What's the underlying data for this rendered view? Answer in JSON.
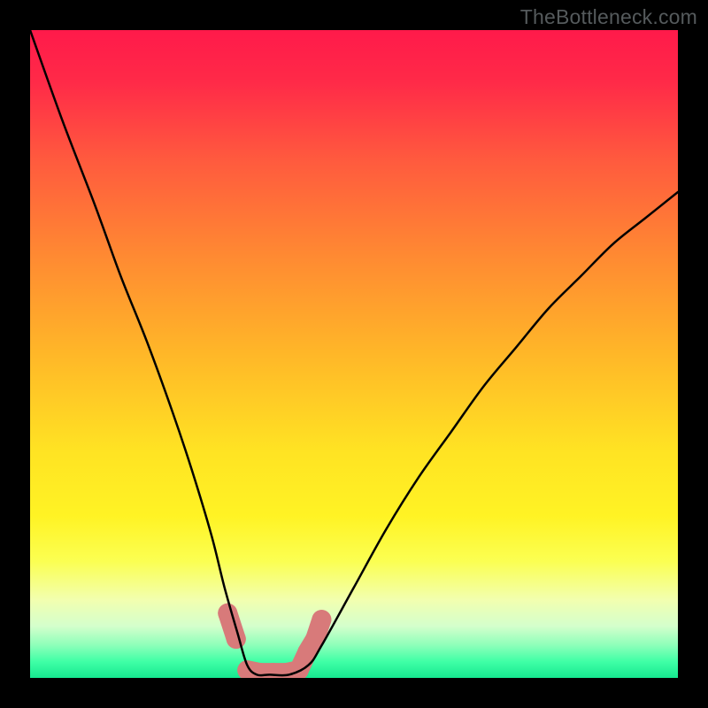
{
  "watermark": "TheBottleneck.com",
  "chart_data": {
    "type": "line",
    "title": "",
    "xlabel": "",
    "ylabel": "",
    "xlim": [
      0,
      100
    ],
    "ylim": [
      0,
      100
    ],
    "grid": false,
    "legend": false,
    "background_gradient": [
      {
        "stop": 0.0,
        "color": "#ff1a4a"
      },
      {
        "stop": 0.08,
        "color": "#ff2a48"
      },
      {
        "stop": 0.2,
        "color": "#ff5a3e"
      },
      {
        "stop": 0.35,
        "color": "#ff8a32"
      },
      {
        "stop": 0.5,
        "color": "#ffb728"
      },
      {
        "stop": 0.65,
        "color": "#ffe323"
      },
      {
        "stop": 0.75,
        "color": "#fff324"
      },
      {
        "stop": 0.82,
        "color": "#fbff52"
      },
      {
        "stop": 0.88,
        "color": "#f2ffb0"
      },
      {
        "stop": 0.92,
        "color": "#d4ffcc"
      },
      {
        "stop": 0.95,
        "color": "#8cffb9"
      },
      {
        "stop": 0.975,
        "color": "#3fffa6"
      },
      {
        "stop": 1.0,
        "color": "#16e890"
      }
    ],
    "series": [
      {
        "name": "bottleneck-curve",
        "stroke": "#000000",
        "stroke_width": 2.5,
        "x": [
          0,
          5,
          10,
          14,
          18,
          22,
          25,
          28,
          30,
          32,
          33.5,
          35,
          37,
          40,
          43,
          45,
          50,
          55,
          60,
          65,
          70,
          75,
          80,
          85,
          90,
          95,
          100
        ],
        "y": [
          100,
          86,
          73,
          62,
          52,
          41,
          32,
          22,
          14,
          7,
          2,
          0.5,
          0.5,
          0.5,
          2,
          5,
          14,
          23,
          31,
          38,
          45,
          51,
          57,
          62,
          67,
          71,
          75
        ]
      },
      {
        "name": "marker-blobs",
        "type": "scatter",
        "fill": "#d87a7a",
        "radius": 11,
        "x": [
          30.5,
          31.8,
          33.5,
          35.5,
          37.5,
          39.5,
          41.5,
          42.8,
          44.0,
          45.0
        ],
        "y": [
          10,
          6,
          1.2,
          0.8,
          0.8,
          0.8,
          1.2,
          4,
          6,
          9
        ]
      }
    ]
  }
}
